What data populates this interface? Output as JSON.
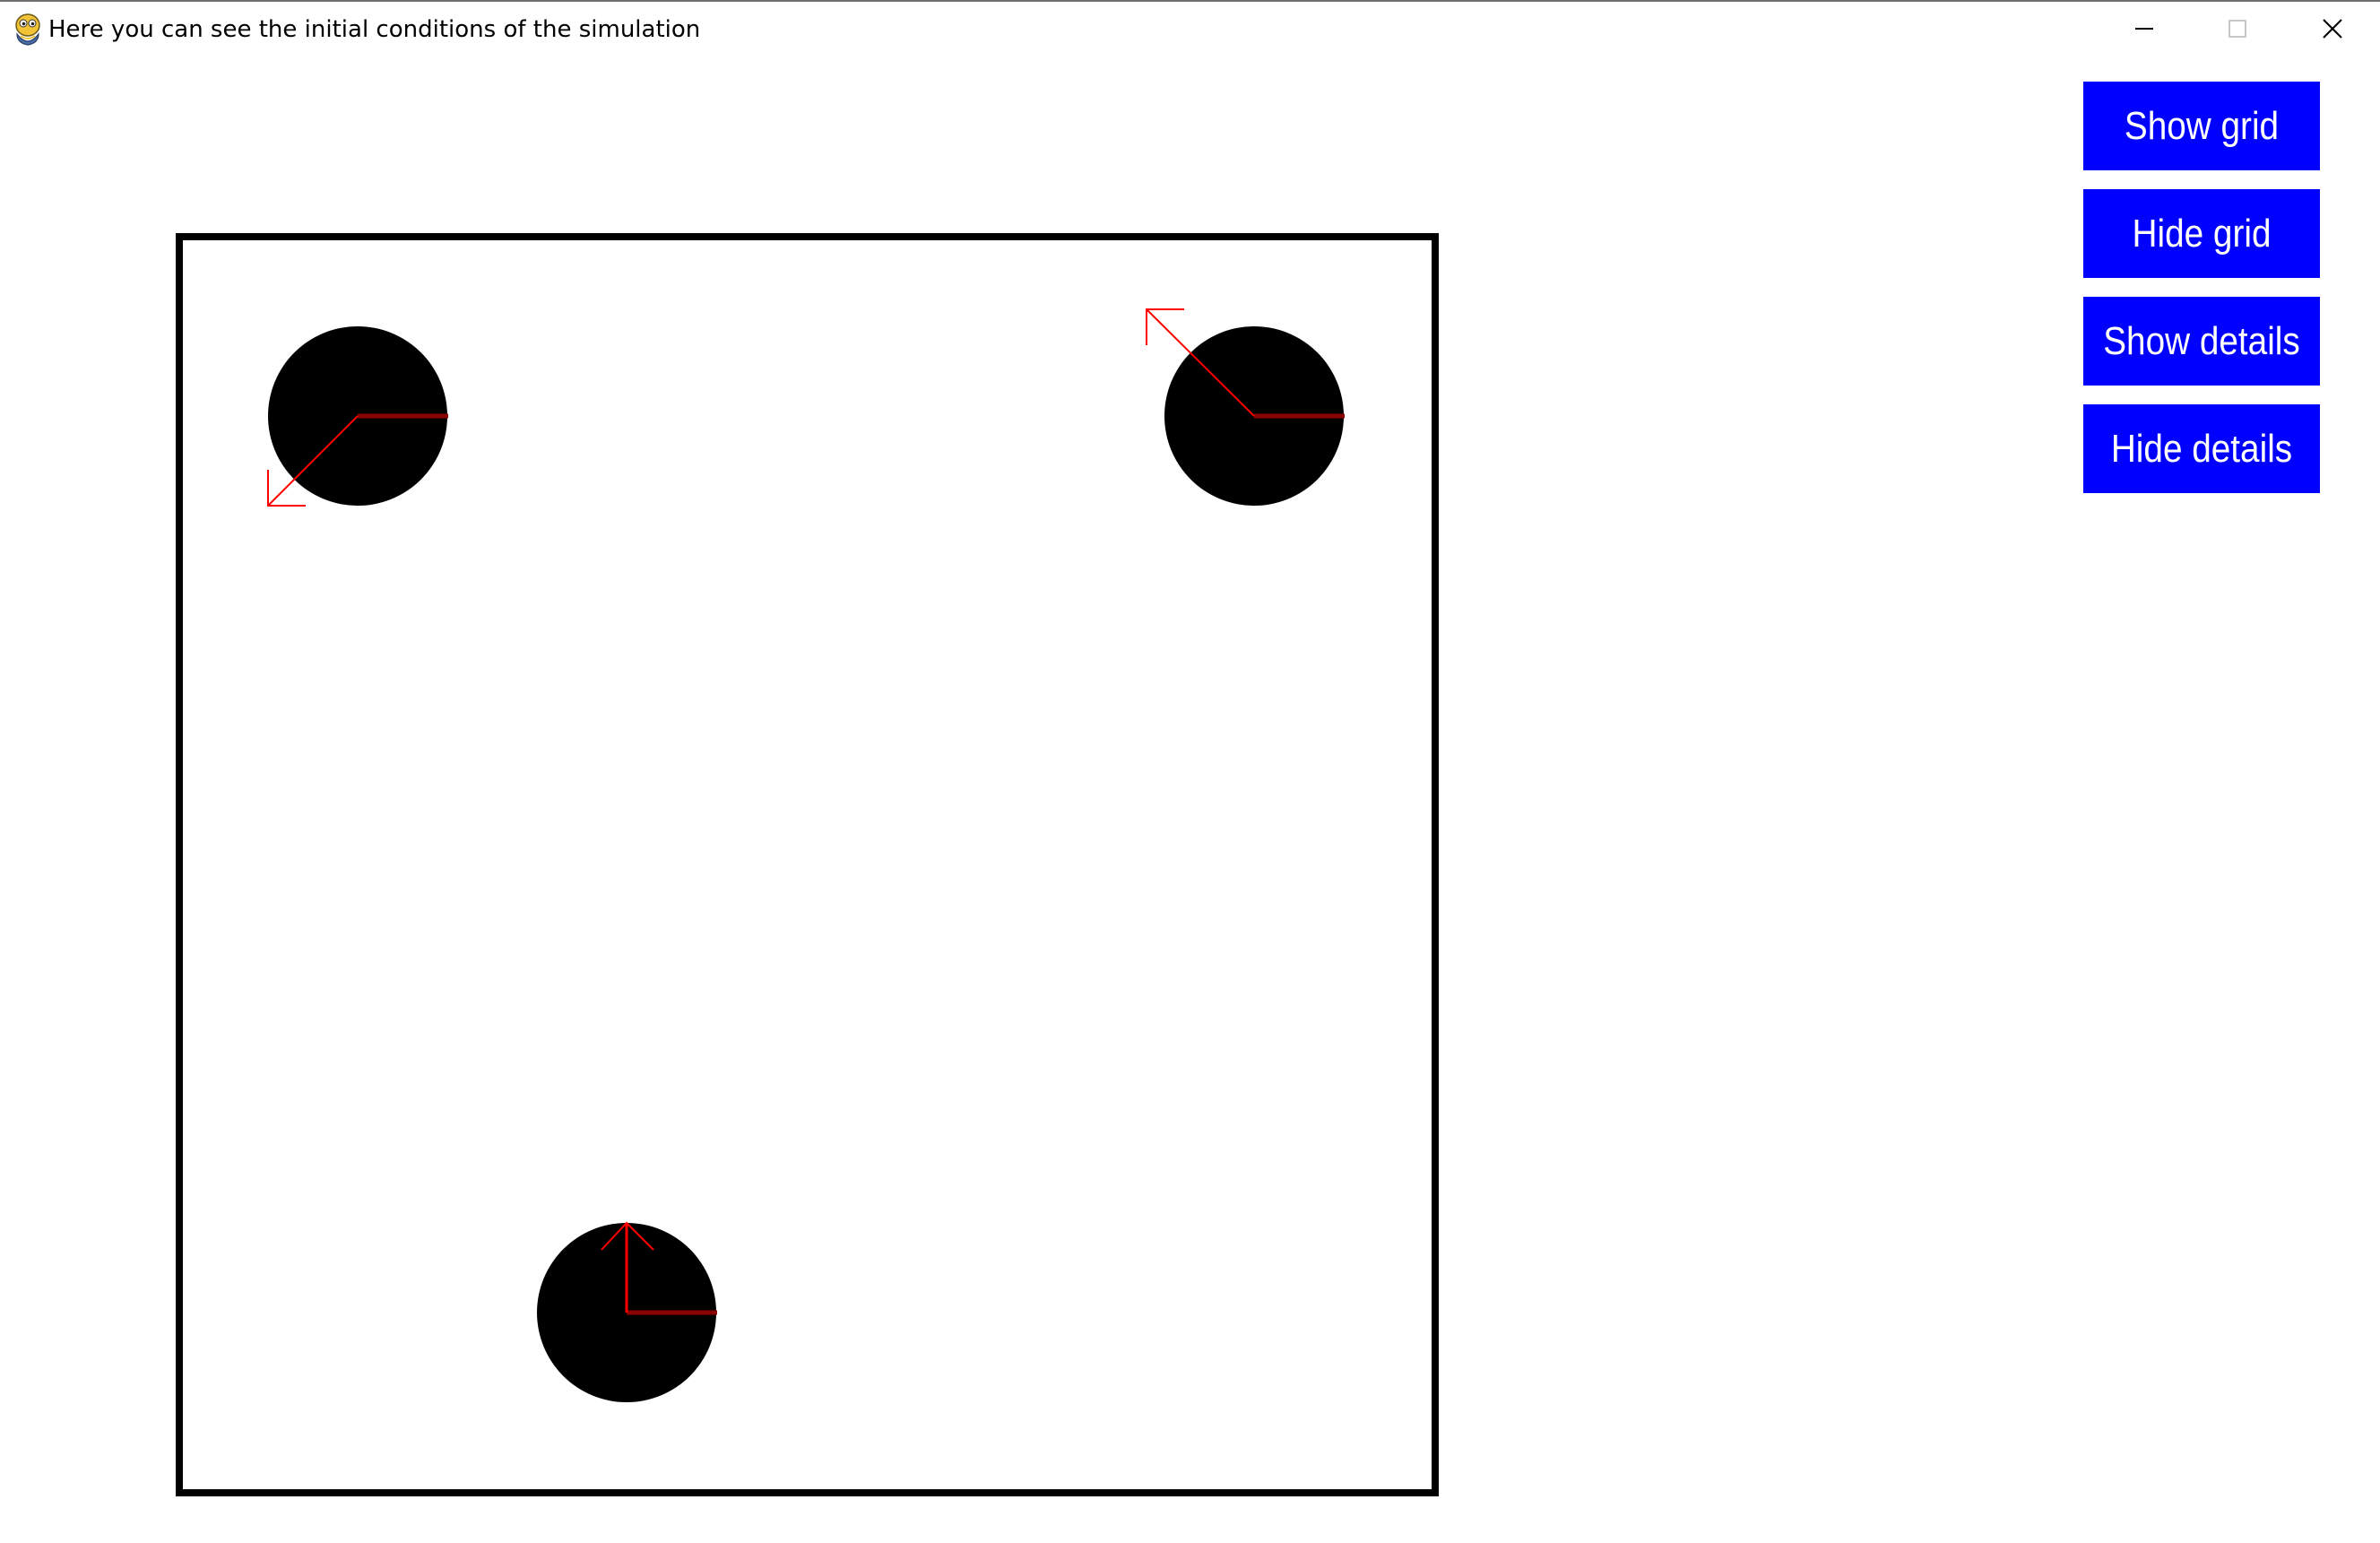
{
  "window": {
    "title": "Here you can see the initial conditions of the simulation",
    "app_icon": "python-snake-icon",
    "controls": {
      "minimize_icon": "minimize-icon",
      "maximize_icon": "maximize-icon",
      "close_icon": "close-icon"
    }
  },
  "buttons": {
    "show_grid": "Show grid",
    "hide_grid": "Hide grid",
    "show_details": "Show details",
    "hide_details": "Hide details"
  },
  "colors": {
    "button_bg": "#0000ff",
    "button_text": "#ffffff",
    "particle": "#000000",
    "vector": "#ff0000",
    "heading": "#8b0000",
    "border": "#000000"
  }
}
